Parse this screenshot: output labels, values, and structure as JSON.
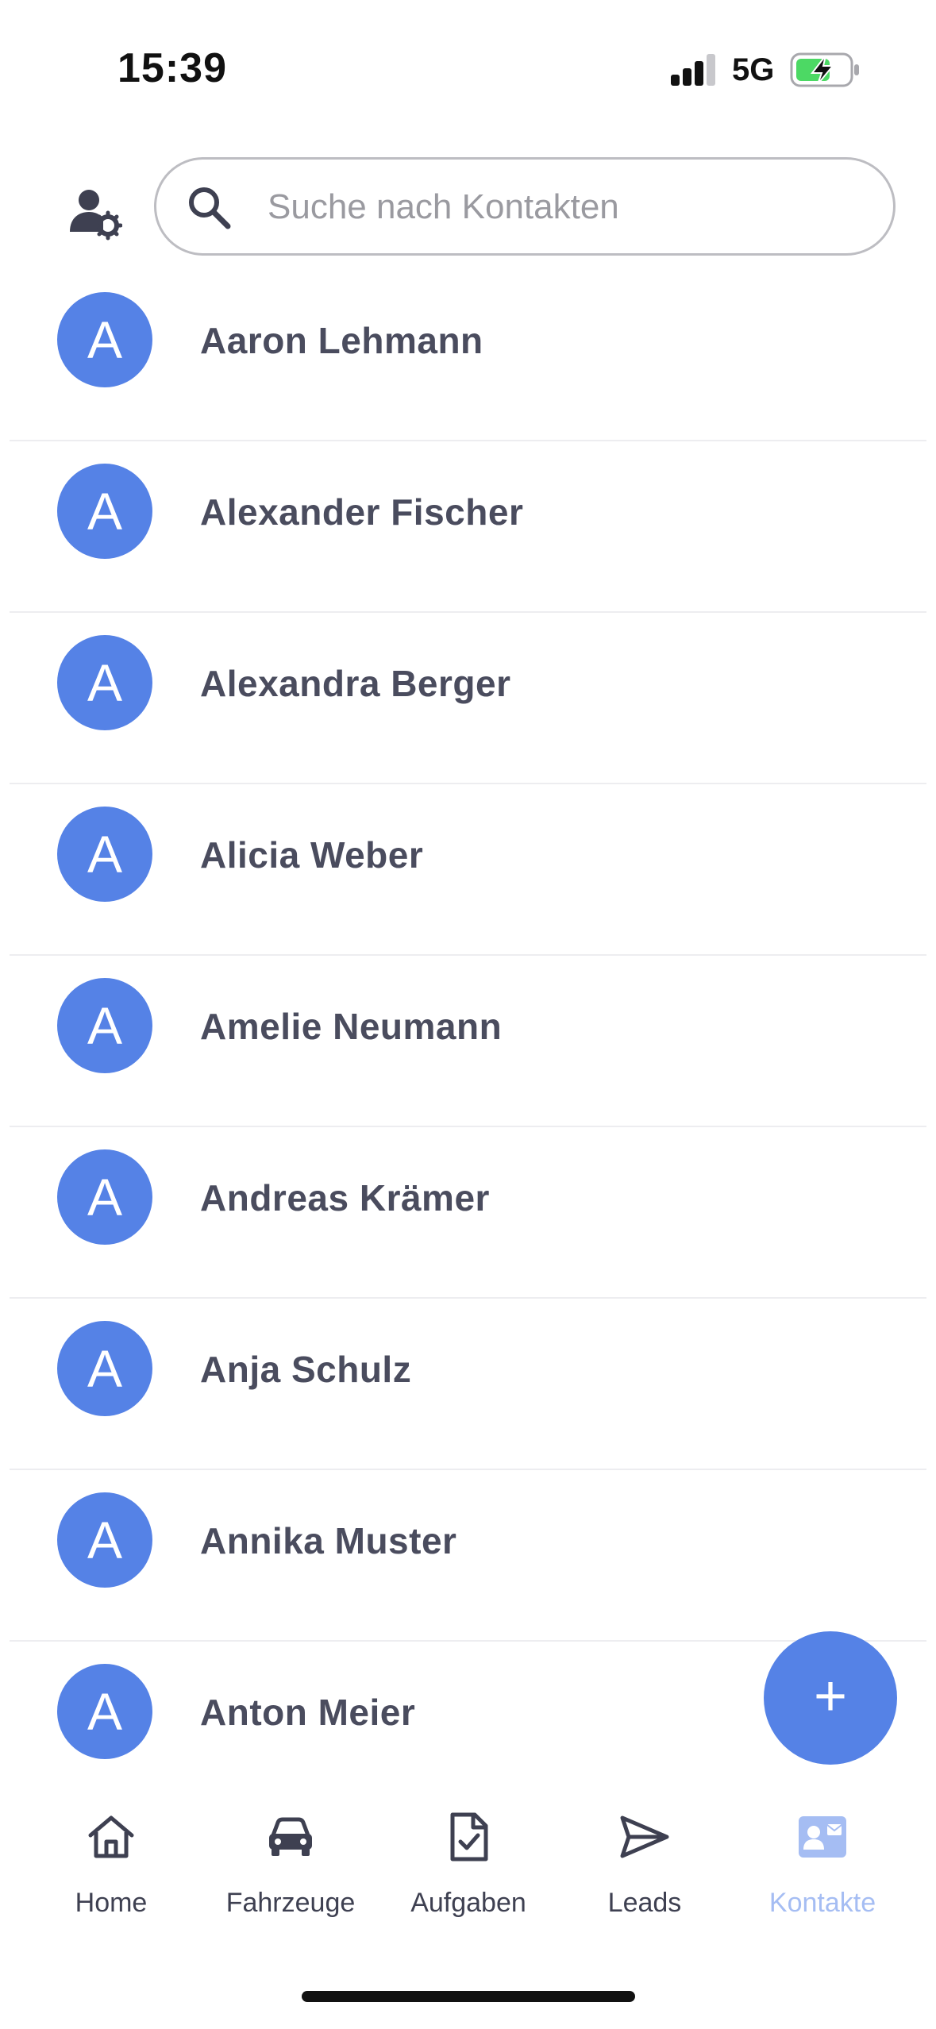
{
  "status_bar": {
    "time": "15:39",
    "network": "5G",
    "signal_bars": 3,
    "battery_charging": true
  },
  "header": {
    "settings_icon": "user-settings-icon",
    "search": {
      "icon": "search-icon",
      "placeholder": "Suche nach Kontakten",
      "value": ""
    }
  },
  "contacts": [
    {
      "initial": "A",
      "name": "Aaron Lehmann"
    },
    {
      "initial": "A",
      "name": "Alexander Fischer"
    },
    {
      "initial": "A",
      "name": "Alexandra Berger"
    },
    {
      "initial": "A",
      "name": "Alicia Weber"
    },
    {
      "initial": "A",
      "name": "Amelie Neumann"
    },
    {
      "initial": "A",
      "name": "Andreas Krämer"
    },
    {
      "initial": "A",
      "name": "Anja Schulz"
    },
    {
      "initial": "A",
      "name": "Annika Muster"
    },
    {
      "initial": "A",
      "name": "Anton Meier"
    }
  ],
  "fab": {
    "label": "+",
    "icon": "plus-icon"
  },
  "tabs": [
    {
      "id": "home",
      "label": "Home",
      "icon": "home-icon",
      "active": false
    },
    {
      "id": "fahrzeuge",
      "label": "Fahrzeuge",
      "icon": "car-icon",
      "active": false
    },
    {
      "id": "aufgaben",
      "label": "Aufgaben",
      "icon": "task-document-icon",
      "active": false
    },
    {
      "id": "leads",
      "label": "Leads",
      "icon": "send-icon",
      "active": false
    },
    {
      "id": "kontakte",
      "label": "Kontakte",
      "icon": "contact-card-icon",
      "active": true
    }
  ],
  "colors": {
    "accent": "#5582e6",
    "active_tab": "#a5bdf3",
    "text": "#4a4c5e",
    "divider": "#ededf0"
  }
}
